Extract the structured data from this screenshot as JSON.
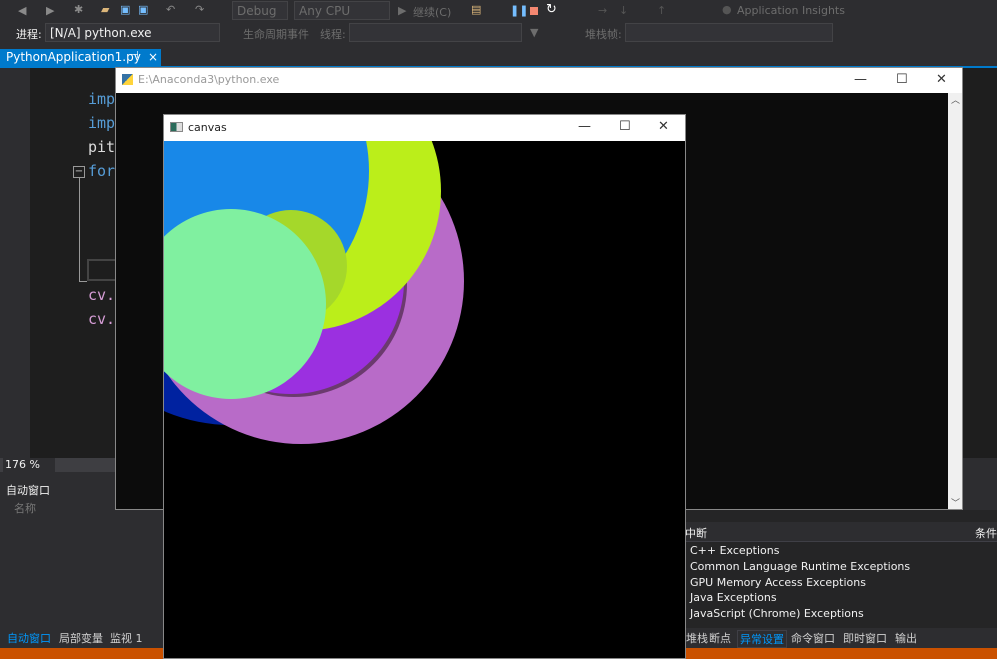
{
  "toolbar": {
    "config": "Debug",
    "platform": "Any CPU",
    "continue_label": "继续(C)",
    "app_insights": "Application Insights"
  },
  "toolbar2": {
    "process_label": "进程:",
    "process_value": "[N/A] python.exe",
    "lifecycle": "生命周期事件",
    "thread_label": "线程:",
    "stack_label": "堆栈帧:"
  },
  "editor": {
    "tab": "PythonApplication1.py",
    "lines": [
      "imp",
      "imp",
      "pit",
      "for",
      "cv.",
      "cv."
    ],
    "zoom": "176 %"
  },
  "console": {
    "title": "E:\\Anaconda3\\python.exe"
  },
  "canvas_window": {
    "title": "canvas",
    "circles": [
      {
        "color": "#0022a0"
      },
      {
        "color": "#b86bc8"
      },
      {
        "color": "#6b3a6e"
      },
      {
        "color": "#9b30e0"
      },
      {
        "color": "#bbee1a"
      },
      {
        "color": "#1888e8"
      },
      {
        "color": "#a5d82a"
      },
      {
        "color": "#80f0a0"
      }
    ]
  },
  "autos": {
    "title": "自动窗口",
    "column": "名称",
    "tabs": [
      "自动窗口",
      "局部变量",
      "监视 1"
    ]
  },
  "exceptions": {
    "header": "中断",
    "condition": "条件",
    "items": [
      "C++ Exceptions",
      "Common Language Runtime Exceptions",
      "GPU Memory Access Exceptions",
      "Java Exceptions",
      "JavaScript (Chrome) Exceptions"
    ],
    "tabs": [
      "堆栈",
      "断点",
      "异常设置",
      "命令窗口",
      "即时窗口",
      "输出"
    ]
  },
  "colors": {
    "accent": "#007acc",
    "status": "#ca5100"
  }
}
